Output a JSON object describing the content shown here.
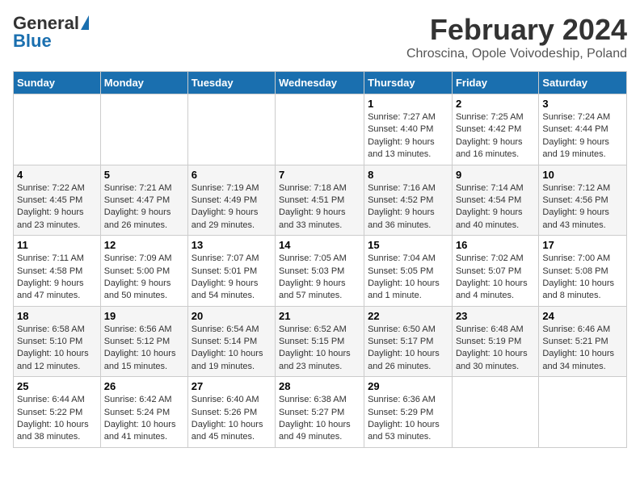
{
  "logo": {
    "general": "General",
    "blue": "Blue"
  },
  "title": "February 2024",
  "subtitle": "Chroscina, Opole Voivodeship, Poland",
  "days_of_week": [
    "Sunday",
    "Monday",
    "Tuesday",
    "Wednesday",
    "Thursday",
    "Friday",
    "Saturday"
  ],
  "weeks": [
    [
      {
        "day": "",
        "info": ""
      },
      {
        "day": "",
        "info": ""
      },
      {
        "day": "",
        "info": ""
      },
      {
        "day": "",
        "info": ""
      },
      {
        "day": "1",
        "info": "Sunrise: 7:27 AM\nSunset: 4:40 PM\nDaylight: 9 hours\nand 13 minutes."
      },
      {
        "day": "2",
        "info": "Sunrise: 7:25 AM\nSunset: 4:42 PM\nDaylight: 9 hours\nand 16 minutes."
      },
      {
        "day": "3",
        "info": "Sunrise: 7:24 AM\nSunset: 4:44 PM\nDaylight: 9 hours\nand 19 minutes."
      }
    ],
    [
      {
        "day": "4",
        "info": "Sunrise: 7:22 AM\nSunset: 4:45 PM\nDaylight: 9 hours\nand 23 minutes."
      },
      {
        "day": "5",
        "info": "Sunrise: 7:21 AM\nSunset: 4:47 PM\nDaylight: 9 hours\nand 26 minutes."
      },
      {
        "day": "6",
        "info": "Sunrise: 7:19 AM\nSunset: 4:49 PM\nDaylight: 9 hours\nand 29 minutes."
      },
      {
        "day": "7",
        "info": "Sunrise: 7:18 AM\nSunset: 4:51 PM\nDaylight: 9 hours\nand 33 minutes."
      },
      {
        "day": "8",
        "info": "Sunrise: 7:16 AM\nSunset: 4:52 PM\nDaylight: 9 hours\nand 36 minutes."
      },
      {
        "day": "9",
        "info": "Sunrise: 7:14 AM\nSunset: 4:54 PM\nDaylight: 9 hours\nand 40 minutes."
      },
      {
        "day": "10",
        "info": "Sunrise: 7:12 AM\nSunset: 4:56 PM\nDaylight: 9 hours\nand 43 minutes."
      }
    ],
    [
      {
        "day": "11",
        "info": "Sunrise: 7:11 AM\nSunset: 4:58 PM\nDaylight: 9 hours\nand 47 minutes."
      },
      {
        "day": "12",
        "info": "Sunrise: 7:09 AM\nSunset: 5:00 PM\nDaylight: 9 hours\nand 50 minutes."
      },
      {
        "day": "13",
        "info": "Sunrise: 7:07 AM\nSunset: 5:01 PM\nDaylight: 9 hours\nand 54 minutes."
      },
      {
        "day": "14",
        "info": "Sunrise: 7:05 AM\nSunset: 5:03 PM\nDaylight: 9 hours\nand 57 minutes."
      },
      {
        "day": "15",
        "info": "Sunrise: 7:04 AM\nSunset: 5:05 PM\nDaylight: 10 hours\nand 1 minute."
      },
      {
        "day": "16",
        "info": "Sunrise: 7:02 AM\nSunset: 5:07 PM\nDaylight: 10 hours\nand 4 minutes."
      },
      {
        "day": "17",
        "info": "Sunrise: 7:00 AM\nSunset: 5:08 PM\nDaylight: 10 hours\nand 8 minutes."
      }
    ],
    [
      {
        "day": "18",
        "info": "Sunrise: 6:58 AM\nSunset: 5:10 PM\nDaylight: 10 hours\nand 12 minutes."
      },
      {
        "day": "19",
        "info": "Sunrise: 6:56 AM\nSunset: 5:12 PM\nDaylight: 10 hours\nand 15 minutes."
      },
      {
        "day": "20",
        "info": "Sunrise: 6:54 AM\nSunset: 5:14 PM\nDaylight: 10 hours\nand 19 minutes."
      },
      {
        "day": "21",
        "info": "Sunrise: 6:52 AM\nSunset: 5:15 PM\nDaylight: 10 hours\nand 23 minutes."
      },
      {
        "day": "22",
        "info": "Sunrise: 6:50 AM\nSunset: 5:17 PM\nDaylight: 10 hours\nand 26 minutes."
      },
      {
        "day": "23",
        "info": "Sunrise: 6:48 AM\nSunset: 5:19 PM\nDaylight: 10 hours\nand 30 minutes."
      },
      {
        "day": "24",
        "info": "Sunrise: 6:46 AM\nSunset: 5:21 PM\nDaylight: 10 hours\nand 34 minutes."
      }
    ],
    [
      {
        "day": "25",
        "info": "Sunrise: 6:44 AM\nSunset: 5:22 PM\nDaylight: 10 hours\nand 38 minutes."
      },
      {
        "day": "26",
        "info": "Sunrise: 6:42 AM\nSunset: 5:24 PM\nDaylight: 10 hours\nand 41 minutes."
      },
      {
        "day": "27",
        "info": "Sunrise: 6:40 AM\nSunset: 5:26 PM\nDaylight: 10 hours\nand 45 minutes."
      },
      {
        "day": "28",
        "info": "Sunrise: 6:38 AM\nSunset: 5:27 PM\nDaylight: 10 hours\nand 49 minutes."
      },
      {
        "day": "29",
        "info": "Sunrise: 6:36 AM\nSunset: 5:29 PM\nDaylight: 10 hours\nand 53 minutes."
      },
      {
        "day": "",
        "info": ""
      },
      {
        "day": "",
        "info": ""
      }
    ]
  ]
}
